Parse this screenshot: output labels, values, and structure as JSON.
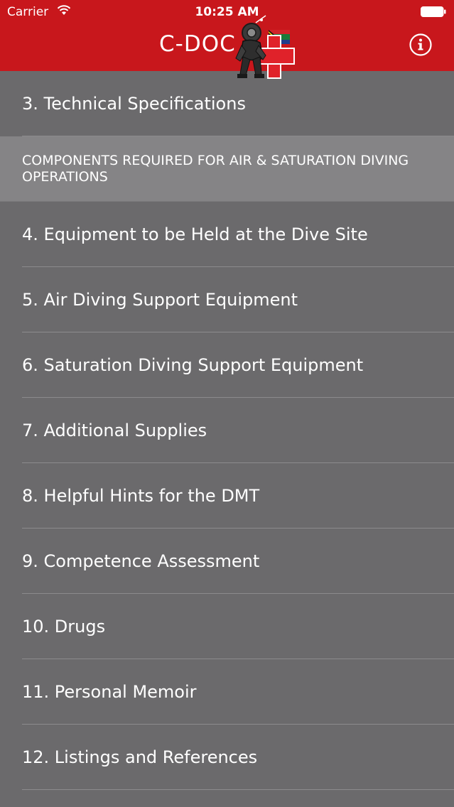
{
  "status_bar": {
    "carrier": "Carrier",
    "time": "10:25 AM",
    "wifi_icon": "wifi-icon",
    "battery_icon": "battery-icon"
  },
  "nav": {
    "title": "C-DOC",
    "logo_icon": "diver-with-red-cross-logo",
    "info_icon": "info-circle-icon"
  },
  "list": {
    "items": [
      {
        "label": "3. Technical Specifications",
        "type": "item"
      },
      {
        "label": "COMPONENTS REQUIRED FOR AIR & SATURATION DIVING OPERATIONS",
        "type": "section"
      },
      {
        "label": "4. Equipment to be Held at the Dive Site",
        "type": "item"
      },
      {
        "label": "5. Air Diving Support Equipment",
        "type": "item"
      },
      {
        "label": "6. Saturation Diving Support Equipment",
        "type": "item"
      },
      {
        "label": "7. Additional Supplies",
        "type": "item"
      },
      {
        "label": "8. Helpful Hints for the DMT",
        "type": "item"
      },
      {
        "label": "9. Competence Assessment",
        "type": "item"
      },
      {
        "label": "10. Drugs",
        "type": "item"
      },
      {
        "label": "11. Personal Memoir",
        "type": "item"
      },
      {
        "label": "12. Listings and References",
        "type": "item"
      }
    ]
  },
  "colors": {
    "header": "#c8171c",
    "background": "#6b6a6c",
    "section_background": "#858486",
    "text": "#ffffff"
  }
}
